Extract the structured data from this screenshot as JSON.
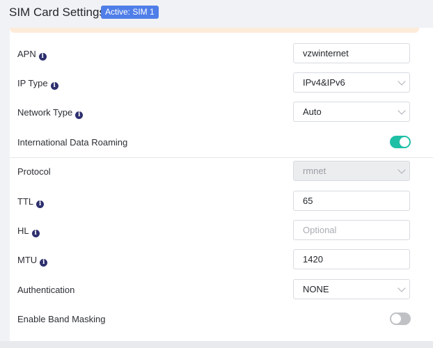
{
  "header": {
    "title": "SIM Card Settings",
    "badge": "Active: SIM 1"
  },
  "fields": {
    "apn": {
      "label": "APN",
      "value": "vzwinternet"
    },
    "ip_type": {
      "label": "IP Type",
      "value": "IPv4&IPv6"
    },
    "network_type": {
      "label": "Network Type",
      "value": "Auto"
    },
    "roaming": {
      "label": "International Data Roaming",
      "enabled": true
    },
    "protocol": {
      "label": "Protocol",
      "value": "rmnet"
    },
    "ttl": {
      "label": "TTL",
      "value": "65"
    },
    "hl": {
      "label": "HL",
      "placeholder": "Optional"
    },
    "mtu": {
      "label": "MTU",
      "value": "1420"
    },
    "authentication": {
      "label": "Authentication",
      "value": "NONE"
    },
    "band_masking": {
      "label": "Enable Band Masking",
      "enabled": false
    }
  },
  "icons": {
    "info": "i"
  },
  "colors": {
    "accent": "#1fbfa6",
    "badge": "#4f7ee8",
    "info_icon": "#2d2f6e"
  }
}
